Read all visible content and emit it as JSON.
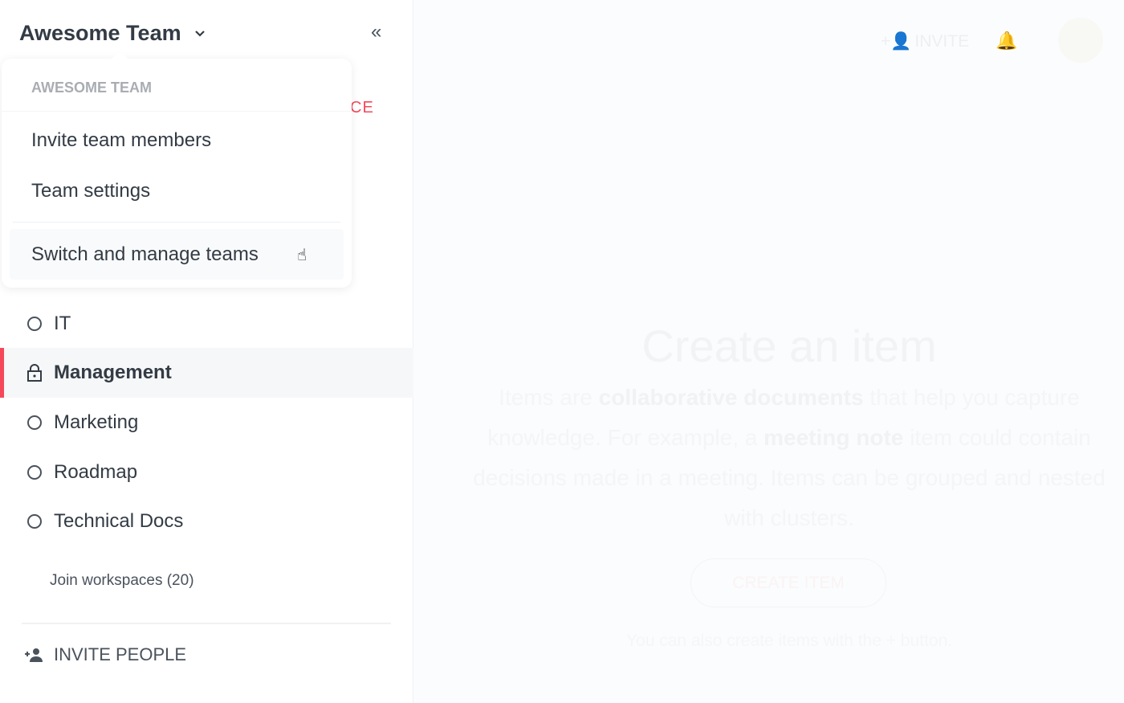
{
  "sidebar": {
    "team_name": "Awesome Team",
    "section_label_fragment": "CE",
    "workspaces": [
      {
        "label": "IT",
        "icon": "circle-icon",
        "active": false
      },
      {
        "label": "Management",
        "icon": "lock-icon",
        "active": true
      },
      {
        "label": "Marketing",
        "icon": "circle-icon",
        "active": false
      },
      {
        "label": "Roadmap",
        "icon": "circle-icon",
        "active": false
      },
      {
        "label": "Technical Docs",
        "icon": "circle-icon",
        "active": false
      }
    ],
    "join_workspaces": "Join workspaces (20)",
    "invite_people": "INVITE PEOPLE"
  },
  "dropdown": {
    "header": "AWESOME TEAM",
    "items": [
      "Invite team members",
      "Team settings",
      "Switch and manage teams"
    ]
  },
  "topbar": {
    "invite": "INVITE"
  },
  "main": {
    "title": "Create an item",
    "desc_parts": [
      "Items are ",
      "collaborative documents",
      " that help you capture knowledge. For example, a ",
      "meeting note",
      " item could contain decisions made in a meeting. Items can be grouped and nested with clusters."
    ],
    "create_button": "CREATE ITEM",
    "hint": "You can also create items with the + button."
  },
  "colors": {
    "accent": "#f5485a",
    "text": "#333b45"
  }
}
